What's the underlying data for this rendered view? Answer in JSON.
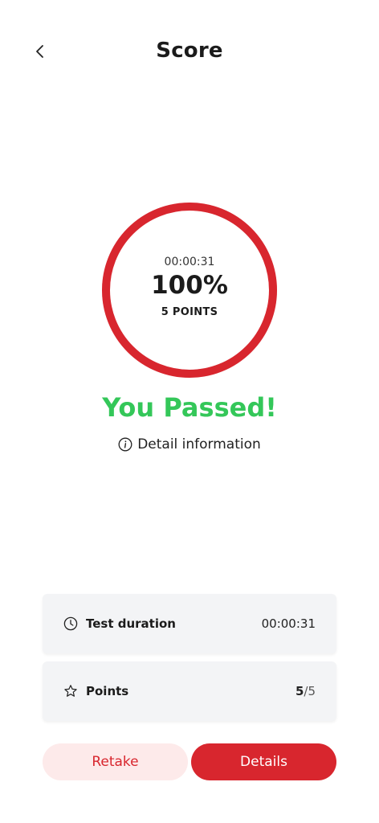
{
  "header": {
    "title": "Score",
    "back_icon": "chevron-left-icon"
  },
  "score": {
    "time": "00:00:31",
    "percent_label": "100%",
    "percent": 100,
    "points_label": "5 POINTS",
    "ring_color": "#d8262e"
  },
  "result": {
    "text": "You Passed!",
    "color": "#34c759"
  },
  "detail_info": {
    "label": "Detail information",
    "icon": "info-circle-icon"
  },
  "cards": {
    "duration": {
      "label": "Test duration",
      "value": "00:00:31",
      "icon": "clock-icon"
    },
    "points": {
      "label": "Points",
      "earned": "5",
      "separator": "/",
      "total": "5",
      "icon": "star-icon"
    }
  },
  "actions": {
    "retake_label": "Retake",
    "details_label": "Details",
    "accent": "#d8262e"
  }
}
